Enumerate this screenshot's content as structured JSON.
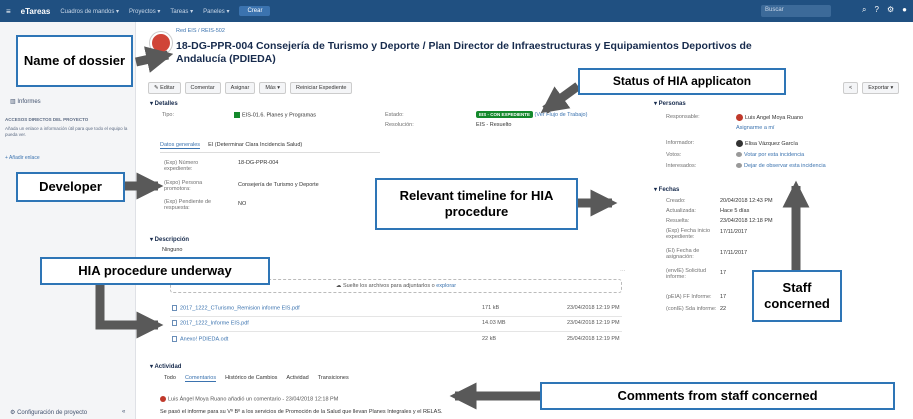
{
  "topnav": {
    "logo": "eTareas",
    "menus": [
      "Cuadros de mandos ▾",
      "Proyectos ▾",
      "Tareas ▾",
      "Paneles ▾"
    ],
    "create": "Crear",
    "search_placeholder": "Buscar"
  },
  "sidebar": {
    "informes": "Informes",
    "access_heading": "ACCESOS DIRECTOS DEL PROYECTO",
    "access_text": "Añada un enlace a información útil para que todo el equipo la pueda ver.",
    "add_link": "+ Añadir enlace",
    "config": "Configuración de proyecto",
    "collapse": "«"
  },
  "issue": {
    "breadcrumb": "Red EIS / REIS-502",
    "title": "18-DG-PPR-004 Consejería de Turismo y Deporte / Plan Director de Infraestructuras y Equipamientos Deportivos de Andalucía (PDIEDA)"
  },
  "toolbar": {
    "buttons": [
      "✎ Editar",
      "Comentar",
      "Asignar",
      "Más ▾",
      "Reiniciar Expediente"
    ],
    "right": [
      "<",
      "Exportar ▾"
    ]
  },
  "details": {
    "heading": "▾ Detalles",
    "tipo_label": "Tipo:",
    "tipo_value": "EIS-01.6. Planes y Programas",
    "estado_label": "Estado:",
    "estado_value": "EIS - CON EXPEDIENTE",
    "estado_link": "(Ver Flujo de Trabajo)",
    "resolucion_label": "Resolución:",
    "resolucion_value": "EIS - Resuelto"
  },
  "tabs": {
    "active": "Datos generales",
    "other": "EI (Determinar Clara Incidencia Salud)"
  },
  "general": {
    "numero_label": "(Exp) Número expediente:",
    "numero_value": "18-DG-PPR-004",
    "persona_label": "(Expo) Persona promotora:",
    "persona_value": "Consejería de Turismo y Deporte",
    "pendiente_label": "(Exp) Pendiente de respuesta:",
    "pendiente_value": "NO"
  },
  "description": {
    "heading": "▾ Descripción",
    "value": "Ninguno"
  },
  "attachments": {
    "dropzone": "Suelte los archivos para adjuntarlos o",
    "dropzone_link": "explorar",
    "files": [
      {
        "name": "2017_1222_CTurismo_Remision informe EIS.pdf",
        "size": "171 kB",
        "date": "23/04/2018 12:19 PM"
      },
      {
        "name": "2017_1222_Informe EIS.pdf",
        "size": "14.03 MB",
        "date": "23/04/2018 12:19 PM"
      },
      {
        "name": "Anexo! PDIEDA.odt",
        "size": "22 kB",
        "date": "25/04/2018 12:19 PM"
      }
    ]
  },
  "people": {
    "heading": "▾ Personas",
    "responsable_label": "Responsable:",
    "responsable_value": "Luis Angel Moya Ruano",
    "assign_me": "Asignarme a mí",
    "informador_label": "Informador:",
    "informador_value": "Elisa Vázquez García",
    "votos_label": "Votos:",
    "votos_value": "Votar por esta incidencia",
    "interesados_label": "Interesados:",
    "interesados_value": "Dejar de observar esta incidencia"
  },
  "dates": {
    "heading": "▾ Fechas",
    "rows": [
      {
        "label": "Creado:",
        "value": "20/04/2018 12:43 PM"
      },
      {
        "label": "Actualizada:",
        "value": "Hace 5 días"
      },
      {
        "label": "Resuelta:",
        "value": "23/04/2018 12:18 PM"
      },
      {
        "label": "(Exp) Fecha inicio expediente:",
        "value": "17/11/2017"
      },
      {
        "label": "(EI) Fecha de asignación:",
        "value": "17/11/2017"
      },
      {
        "label": "(envIE) Solicitud informe:",
        "value": "17"
      },
      {
        "label": "(pEIA) FF Informe:",
        "value": "17"
      },
      {
        "label": "(conIE) Sda informe:",
        "value": "22"
      }
    ]
  },
  "activity": {
    "heading": "▾ Actividad",
    "tabs": [
      "Todo",
      "Comentarios",
      "Histórico de Cambios",
      "Actividad",
      "Transiciones"
    ],
    "active_tab": "Comentarios",
    "comment_author": "Luis Ángel Moya Ruano añadió un comentario - 23/04/2018 12:18 PM",
    "comment_text": "Se pasó el informe para su Vº Bº a los servicios de Promoción de la Salud que llevan Planes Integrales y el RELAS."
  },
  "callouts": {
    "dossier": "Name of dossier",
    "status": "Status of HIA applicaton",
    "developer": "Developer",
    "timeline": "Relevant timeline for HIA procedure",
    "underway": "HIA procedure underway",
    "staff": "Staff concerned",
    "comments": "Comments from staff concerned"
  },
  "colors": {
    "nav": "#205081",
    "callout_border": "#2e75b6",
    "arrow": "#595959",
    "status_green": "#14892c"
  }
}
